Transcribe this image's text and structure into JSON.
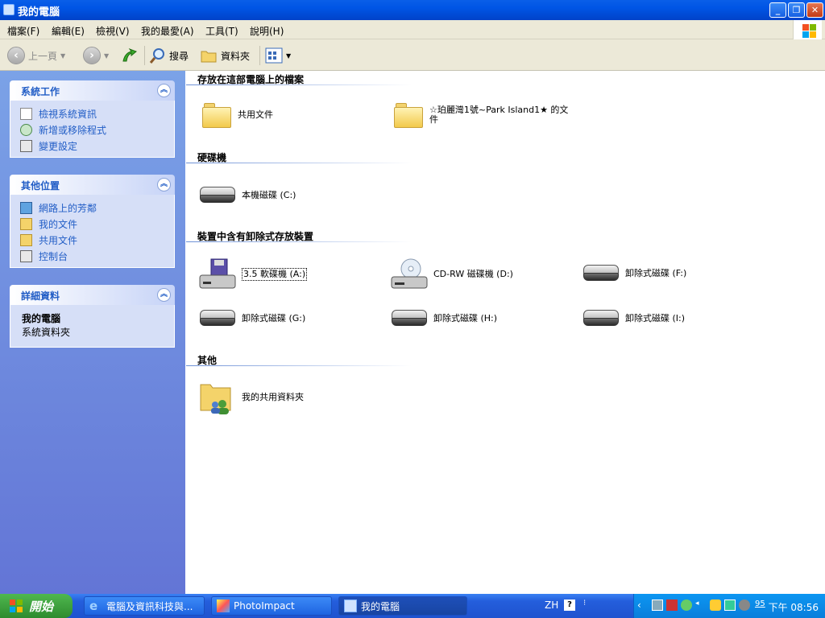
{
  "window": {
    "title": "我的電腦"
  },
  "menu": [
    "檔案(F)",
    "編輯(E)",
    "檢視(V)",
    "我的最愛(A)",
    "工具(T)",
    "說明(H)"
  ],
  "toolbar": {
    "back": "上一頁",
    "search": "搜尋",
    "folders": "資料夾"
  },
  "sidebar": {
    "system_tasks": {
      "title": "系統工作",
      "items": [
        "檢視系統資訊",
        "新增或移除程式",
        "變更設定"
      ]
    },
    "other_places": {
      "title": "其他位置",
      "items": [
        "網路上的芳鄰",
        "我的文件",
        "共用文件",
        "控制台"
      ]
    },
    "details": {
      "title": "詳細資料",
      "name": "我的電腦",
      "type": "系統資料夾"
    }
  },
  "main": {
    "files_group": {
      "title": "存放在這部電腦上的檔案",
      "items": [
        "共用文件",
        "☆珀麗灣1號~Park Island1★ 的文件"
      ]
    },
    "hdd_group": {
      "title": "硬碟機",
      "items": [
        "本機磁碟 (C:)"
      ]
    },
    "removable_group": {
      "title": "裝置中含有卸除式存放裝置",
      "items": [
        "3.5 軟碟機 (A:)",
        "CD-RW 磁碟機 (D:)",
        "卸除式磁碟 (F:)",
        "卸除式磁碟 (G:)",
        "卸除式磁碟 (H:)",
        "卸除式磁碟 (I:)"
      ]
    },
    "other_group": {
      "title": "其他",
      "items": [
        "我的共用資料夾"
      ]
    }
  },
  "taskbar": {
    "start": "開始",
    "tasks": [
      "電腦及資訊科技與...",
      "PhotoImpact",
      "我的電腦"
    ],
    "lang": "ZH",
    "tray_number": "95",
    "clock": "下午 08:56"
  },
  "colors": {
    "titlebar": "#0055E5",
    "sidebar_top": "#7BA2E7",
    "sidebar_bottom": "#6375D6",
    "link": "#215DC6",
    "taskbar": "#245EDC",
    "start": "#3C9F3C"
  }
}
